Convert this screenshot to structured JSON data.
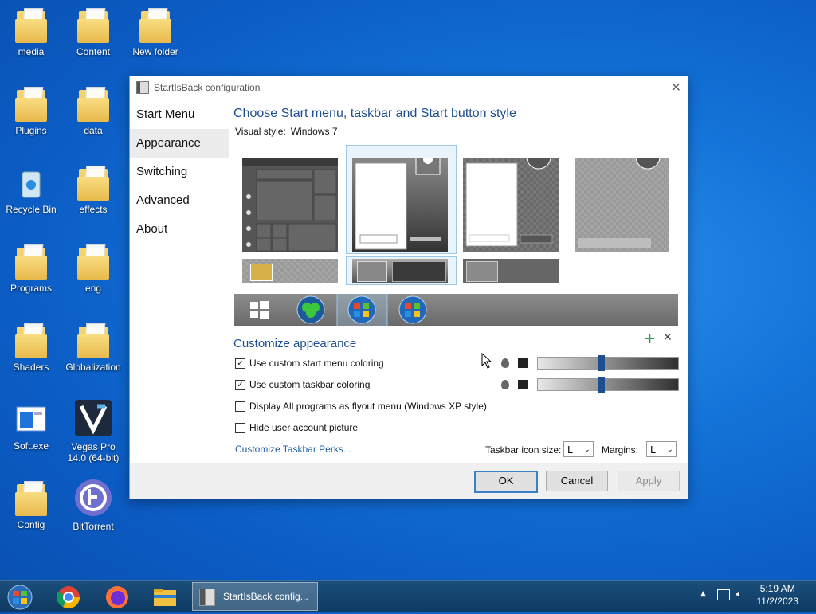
{
  "desktop": {
    "icons": [
      {
        "label": "media"
      },
      {
        "label": "Content"
      },
      {
        "label": "New folder"
      },
      {
        "label": "Plugins"
      },
      {
        "label": "data"
      },
      {
        "label": "Recycle Bin"
      },
      {
        "label": "effects"
      },
      {
        "label": "Programs"
      },
      {
        "label": "eng"
      },
      {
        "label": "Shaders"
      },
      {
        "label": "Globalization"
      },
      {
        "label": "Soft.exe"
      },
      {
        "label": "Vegas Pro 14.0 (64-bit)"
      },
      {
        "label": "Config"
      },
      {
        "label": "BitTorrent"
      }
    ]
  },
  "dialog": {
    "title": "StartIsBack configuration",
    "nav": [
      "Start Menu",
      "Appearance",
      "Switching",
      "Advanced",
      "About"
    ],
    "active_nav": "Appearance",
    "heading": "Choose Start menu, taskbar and Start button style",
    "visual_style_label": "Visual style:",
    "visual_style_value": "Windows 7",
    "customize_heading": "Customize appearance",
    "options": [
      {
        "label": "Use custom start menu coloring",
        "checked": true
      },
      {
        "label": "Use custom taskbar coloring",
        "checked": true
      },
      {
        "label": "Display All programs as flyout menu (Windows XP style)",
        "checked": false
      },
      {
        "label": "Hide user account picture",
        "checked": false
      }
    ],
    "sliders": {
      "start_menu_level": 0.45,
      "taskbar_level": 0.45
    },
    "link": "Customize Taskbar Perks...",
    "icon_size_label": "Taskbar icon size:",
    "icon_size_value": "L",
    "margins_label": "Margins:",
    "margins_value": "L",
    "buttons": {
      "ok": "OK",
      "cancel": "Cancel",
      "apply": "Apply"
    }
  },
  "taskbar": {
    "active_window": "StartIsBack config...",
    "time": "5:19 AM",
    "date": "11/2/2023"
  },
  "colors": {
    "accent": "#1f4f8f",
    "selection": "#9cc7e8"
  }
}
